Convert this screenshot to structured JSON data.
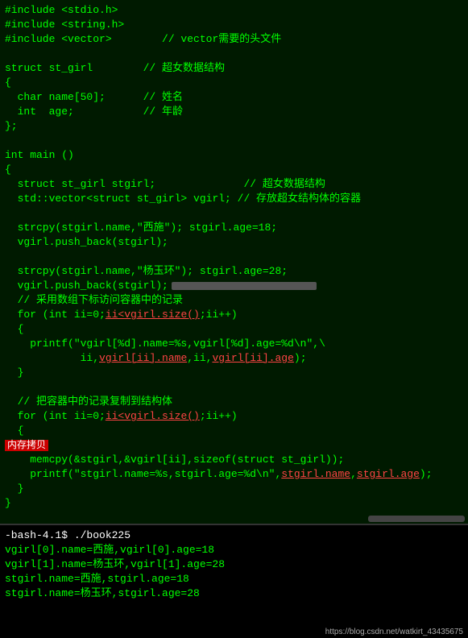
{
  "code": {
    "lines": [
      {
        "text": "#include <stdio.h>",
        "type": "normal"
      },
      {
        "text": "#include <string.h>",
        "type": "normal"
      },
      {
        "text": "#include <vector>        // vector需要的头文件",
        "type": "normal"
      },
      {
        "text": "",
        "type": "normal"
      },
      {
        "text": "struct st_girl        // 超女数据结构",
        "type": "normal"
      },
      {
        "text": "{",
        "type": "normal"
      },
      {
        "text": "  char name[50];      // 姓名",
        "type": "normal"
      },
      {
        "text": "  int  age;           // 年龄",
        "type": "normal"
      },
      {
        "text": "};",
        "type": "normal"
      },
      {
        "text": "",
        "type": "normal"
      },
      {
        "text": "int main ()",
        "type": "normal"
      },
      {
        "text": "{",
        "type": "normal"
      },
      {
        "text": "  struct st_girl stgirl;              // 超女数据结构",
        "type": "normal"
      },
      {
        "text": "  std::vector<struct st_girl> vgirl; // 存放超女结构体的容器",
        "type": "normal"
      },
      {
        "text": "",
        "type": "normal"
      },
      {
        "text": "  strcpy(stgirl.name,\"西施\"); stgirl.age=18;",
        "type": "normal"
      },
      {
        "text": "  vgirl.push_back(stgirl);",
        "type": "normal"
      },
      {
        "text": "",
        "type": "normal"
      },
      {
        "text": "  strcpy(stgirl.name,\"杨玉环\"); stgirl.age=28;",
        "type": "normal"
      },
      {
        "text": "  vgirl.push_back(stgirl);",
        "type": "special_pushback"
      },
      {
        "text": "  // 采用数组下标访问容器中的记录",
        "type": "normal"
      },
      {
        "text": "  for (int ii=0;ii<vgirl.size();ii++)",
        "type": "for_underline1"
      },
      {
        "text": "  {",
        "type": "normal"
      },
      {
        "text": "    printf(\"vgirl[%d].name=%s,vgirl[%d].age=%d\\n\",\\",
        "type": "normal"
      },
      {
        "text": "            ii,vgirl[ii].name,ii,vgirl[ii].age);",
        "type": "printf_underline"
      },
      {
        "text": "  }",
        "type": "normal"
      },
      {
        "text": "",
        "type": "normal"
      },
      {
        "text": "  // 把容器中的记录复制到结构体",
        "type": "normal"
      },
      {
        "text": "  for (int ii=0;ii<vgirl.size();ii++)",
        "type": "for_underline2"
      },
      {
        "text": "  {",
        "type": "normal"
      },
      {
        "text": "    内存拷贝",
        "type": "highlight_label"
      },
      {
        "text": "    memcpy(&stgirl,&vgirl[ii],sizeof(struct st_girl));",
        "type": "normal"
      },
      {
        "text": "    printf(\"stgirl.name=%s,stgirl.age=%d\\n\",stgirl.name,stgirl.age);",
        "type": "printf_underline2"
      },
      {
        "text": "  }",
        "type": "normal"
      },
      {
        "text": "}",
        "type": "normal"
      }
    ]
  },
  "terminal": {
    "prompt": "-bash-4.1$ ./book225",
    "lines": [
      "vgirl[0].name=西施,vgirl[0].age=18",
      "vgirl[1].name=杨玉环,vgirl[1].age=28",
      "stgirl.name=西施,stgirl.age=18",
      "stgirl.name=杨玉环,stgirl.age=28"
    ]
  },
  "watermark": "https://blog.csdn.net/watkirt_43435675"
}
